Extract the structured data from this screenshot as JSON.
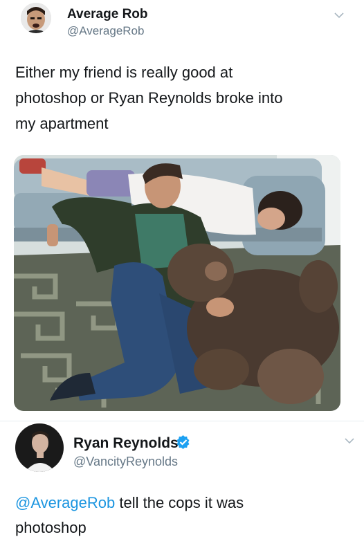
{
  "tweet1": {
    "display_name": "Average Rob",
    "handle": "@AverageRob",
    "text": "Either my friend is really good at\nphotoshop or Ryan Reynolds broke into\nmy apartment",
    "has_photo": true,
    "avatar_icon": "user-avatar-icon",
    "menu_icon": "chevron-down-icon"
  },
  "tweet2": {
    "display_name": "Ryan Reynolds",
    "handle": "@VancityReynolds",
    "verified": true,
    "reply_mention": "@AverageRob",
    "reply_text": " tell the cops it was\nphotoshop",
    "avatar_icon": "user-avatar-icon",
    "menu_icon": "chevron-down-icon"
  },
  "colors": {
    "link": "#1b95e0",
    "verified": "#1da1f2",
    "secondary_text": "#657786"
  }
}
